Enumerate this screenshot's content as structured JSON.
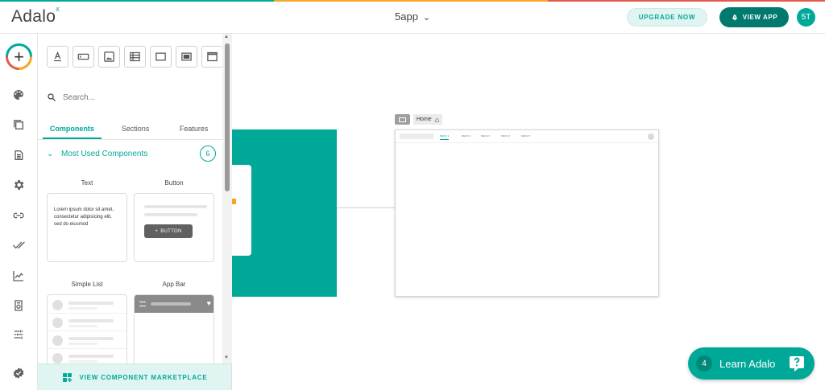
{
  "header": {
    "logo": "Adalo",
    "logo_mark": "x",
    "app_name": "5app",
    "upgrade_label": "UPGRADE NOW",
    "view_app_label": "VIEW APP",
    "avatar_initials": "5T"
  },
  "colors": {
    "brand": "#00a898",
    "brand_dark": "#007a6e",
    "accent_yellow": "#f5a623",
    "accent_red": "#e35a4a"
  },
  "rail": {
    "items": [
      {
        "icon": "palette-icon"
      },
      {
        "icon": "screens-icon"
      },
      {
        "icon": "database-icon"
      },
      {
        "icon": "gear-icon"
      },
      {
        "icon": "link-icon"
      },
      {
        "icon": "double-check-icon"
      },
      {
        "icon": "analytics-icon"
      },
      {
        "icon": "app-settings-icon"
      },
      {
        "icon": "sliders-icon"
      },
      {
        "icon": "verified-badge-icon"
      }
    ]
  },
  "panel": {
    "search_placeholder": "Search...",
    "tabs": [
      "Components",
      "Sections",
      "Features"
    ],
    "active_tab": "Components",
    "section_title": "Most Used Components",
    "section_count": "6",
    "components": {
      "text_label": "Text",
      "text_sample": "Lorem ipsum dolor sit amet, consectetur adipisicing elit, sed do eiusmod",
      "button_label": "Button",
      "button_sample": "BUTTON",
      "list_label": "Simple List",
      "appbar_label": "App Bar"
    },
    "marketplace_label": "VIEW COMPONENT MARKETPLACE"
  },
  "canvas": {
    "screen_name": "Home",
    "menu_items": [
      "MENU 1",
      "MENU 2",
      "MENU 3",
      "MENU 4",
      "MENU 5"
    ]
  },
  "learn": {
    "count": "4",
    "label": "Learn Adalo"
  }
}
